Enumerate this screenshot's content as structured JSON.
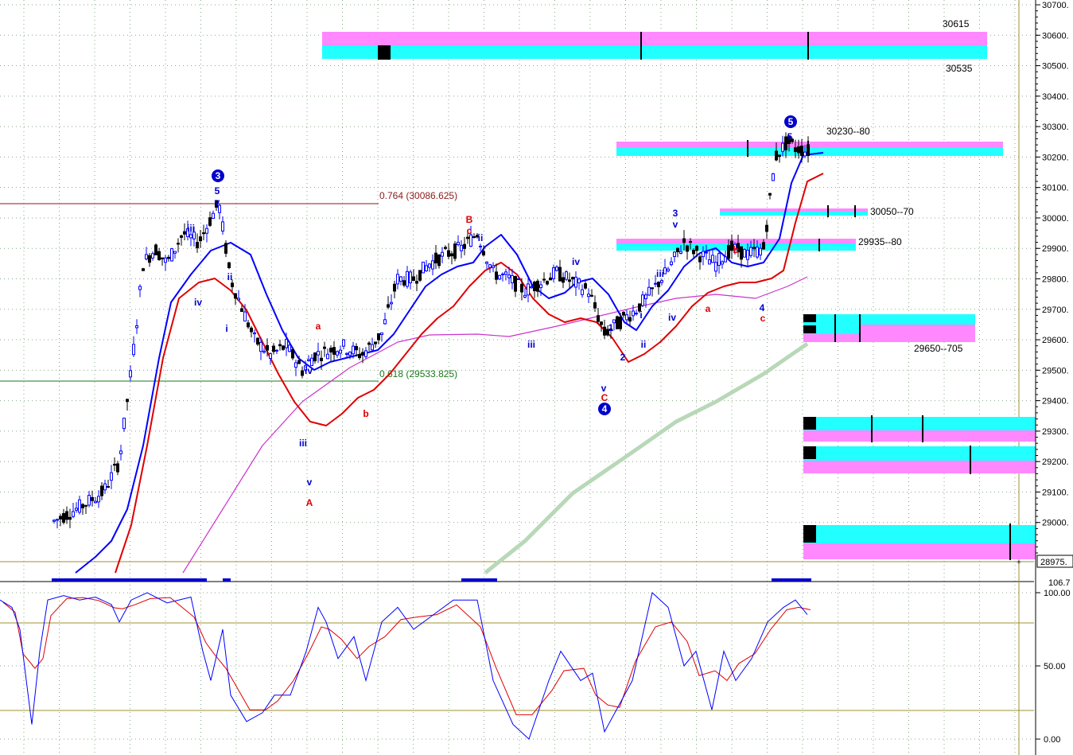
{
  "chart_data": {
    "type": "candlestick",
    "colors": {
      "up_candle": "#0000ff",
      "down_candle": "#000000",
      "ma_blue": "#0000ff",
      "ma_red": "#e00000",
      "ma_magenta": "#cc33cc",
      "ma_green": "#b8d8b8",
      "zone_magenta": "#ff88ff",
      "zone_cyan": "#22ffff",
      "stoch_k": "#0000ff",
      "stoch_d": "#e00000",
      "guide_line": "#a09030"
    },
    "price_axis": {
      "min": 28900,
      "max": 30700,
      "ticks": [
        "30700.",
        "30600.",
        "30500.",
        "30400.",
        "30300.",
        "30200.",
        "30100.",
        "30000.",
        "29900.",
        "29800.",
        "29700.",
        "29600.",
        "29500.",
        "29400.",
        "29300.",
        "29200.",
        "29100.",
        "29000."
      ],
      "last_price_label": "28975.",
      "last_price": 28975
    },
    "osc_axis": {
      "top_label": "106.7",
      "ticks": [
        "100.00",
        "50.00",
        "0.00"
      ],
      "levels": [
        80,
        20
      ]
    },
    "fib_lines": [
      {
        "label": "0.764 (30086.625)",
        "price": 30086.625,
        "color": "#8b1a1a"
      },
      {
        "label": "0.618 (29533.825)",
        "price": 29533.825,
        "color": "#1a7a1a"
      }
    ],
    "zone_labels": [
      {
        "text": "30615",
        "price": 30615
      },
      {
        "text": "30535",
        "price": 30535
      },
      {
        "text": "30230--80",
        "price": 30260
      },
      {
        "text": "30050--70",
        "price": 30060
      },
      {
        "text": "29935--80",
        "price": 29960
      },
      {
        "text": "29650--705",
        "price": 29677
      }
    ],
    "wave_labels": [
      {
        "text": "3",
        "circled": true,
        "color": "#0000cc"
      },
      {
        "text": "5",
        "color": "#0000cc"
      },
      {
        "text": "v",
        "color": "#0000cc"
      },
      {
        "text": "iii",
        "color": "#0000cc"
      },
      {
        "text": "iv",
        "color": "#0000cc"
      },
      {
        "text": "ii",
        "color": "#0000cc"
      },
      {
        "text": "i",
        "color": "#0000cc"
      },
      {
        "text": "iv",
        "color": "#0000cc"
      },
      {
        "text": "iii",
        "color": "#0000cc"
      },
      {
        "text": "v",
        "color": "#0000cc"
      },
      {
        "text": "A",
        "color": "#dd0000"
      },
      {
        "text": "a",
        "color": "#dd0000"
      },
      {
        "text": "b",
        "color": "#dd0000"
      },
      {
        "text": "B",
        "color": "#dd0000"
      },
      {
        "text": "c",
        "color": "#dd0000"
      },
      {
        "text": "ii",
        "color": "#0000cc"
      },
      {
        "text": "iii",
        "color": "#0000cc"
      },
      {
        "text": "iv",
        "color": "#0000cc"
      },
      {
        "text": "v",
        "color": "#0000cc"
      },
      {
        "text": "C",
        "color": "#dd0000"
      },
      {
        "text": "4",
        "circled": true,
        "color": "#0000cc"
      },
      {
        "text": "1",
        "color": "#0000cc"
      },
      {
        "text": "2",
        "color": "#0000cc"
      },
      {
        "text": "i",
        "color": "#0000cc"
      },
      {
        "text": "ii",
        "color": "#0000cc"
      },
      {
        "text": "iii",
        "color": "#0000cc"
      },
      {
        "text": "iv",
        "color": "#0000cc"
      },
      {
        "text": "3",
        "color": "#0000cc"
      },
      {
        "text": "v",
        "color": "#0000cc"
      },
      {
        "text": "a",
        "color": "#dd0000"
      },
      {
        "text": "b",
        "color": "#dd0000"
      },
      {
        "text": "c",
        "color": "#dd0000"
      },
      {
        "text": "4",
        "color": "#0000cc"
      },
      {
        "text": "5",
        "color": "#0000cc"
      },
      {
        "text": "5",
        "circled": true,
        "color": "#0000cc"
      }
    ]
  }
}
